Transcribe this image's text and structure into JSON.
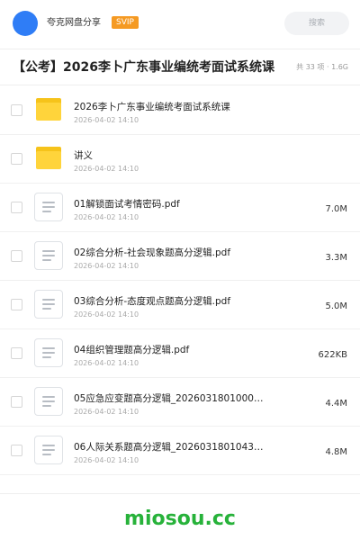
{
  "header": {
    "username": "夸克网盘分享",
    "badge": "SVIP",
    "search_placeholder": "搜索"
  },
  "folder": {
    "title": "【公考】2026李卜广东事业编统考面试系统课",
    "meta": "共 33 项 · 1.6G"
  },
  "files": [
    {
      "type": "folder",
      "name": "2026李卜广东事业编统考面试系统课",
      "date": "2026-04-02 14:10",
      "size": ""
    },
    {
      "type": "folder",
      "name": "讲义",
      "date": "2026-04-02 14:10",
      "size": ""
    },
    {
      "type": "file",
      "name": "01解锁面试考情密码.pdf",
      "date": "2026-04-02 14:10",
      "size": "7.0M"
    },
    {
      "type": "file",
      "name": "02综合分析-社会现象题高分逻辑.pdf",
      "date": "2026-04-02 14:10",
      "size": "3.3M"
    },
    {
      "type": "file",
      "name": "03综合分析-态度观点题高分逻辑.pdf",
      "date": "2026-04-02 14:10",
      "size": "5.0M"
    },
    {
      "type": "file",
      "name": "04组织管理题高分逻辑.pdf",
      "date": "2026-04-02 14:10",
      "size": "622KB"
    },
    {
      "type": "file",
      "name": "05应急应变题高分逻辑_2026031801000…",
      "date": "2026-04-02 14:10",
      "size": "4.4M"
    },
    {
      "type": "file",
      "name": "06人际关系题高分逻辑_2026031801043…",
      "date": "2026-04-02 14:10",
      "size": "4.8M"
    }
  ],
  "watermark": "miosou.cc",
  "colors": {
    "avatar": "#2f7df6",
    "badge": "#f59a23",
    "folder": "#ffd43b",
    "watermark": "#27b23a"
  },
  "icons": {
    "folder": "folder-icon",
    "file": "document-icon"
  }
}
